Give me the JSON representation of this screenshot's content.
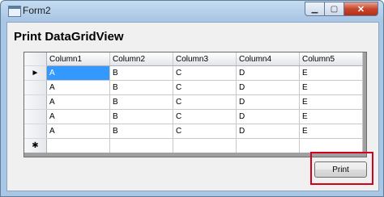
{
  "window": {
    "title": "Form2",
    "minimize_glyph": "▁",
    "maximize_glyph": "▢",
    "close_glyph": "✕"
  },
  "heading": "Print DataGridView",
  "grid": {
    "current_row_glyph": "►",
    "new_row_glyph": "✱",
    "columns": [
      "Column1",
      "Column2",
      "Column3",
      "Column4",
      "Column5"
    ],
    "rows": [
      [
        "A",
        "B",
        "C",
        "D",
        "E"
      ],
      [
        "A",
        "B",
        "C",
        "D",
        "E"
      ],
      [
        "A",
        "B",
        "C",
        "D",
        "E"
      ],
      [
        "A",
        "B",
        "C",
        "D",
        "E"
      ],
      [
        "A",
        "B",
        "C",
        "D",
        "E"
      ]
    ],
    "new_row": [
      "",
      "",
      "",
      "",
      ""
    ]
  },
  "print_button": {
    "label": "Print"
  },
  "colors": {
    "selection": "#3399ff",
    "highlight": "#d6001c"
  }
}
